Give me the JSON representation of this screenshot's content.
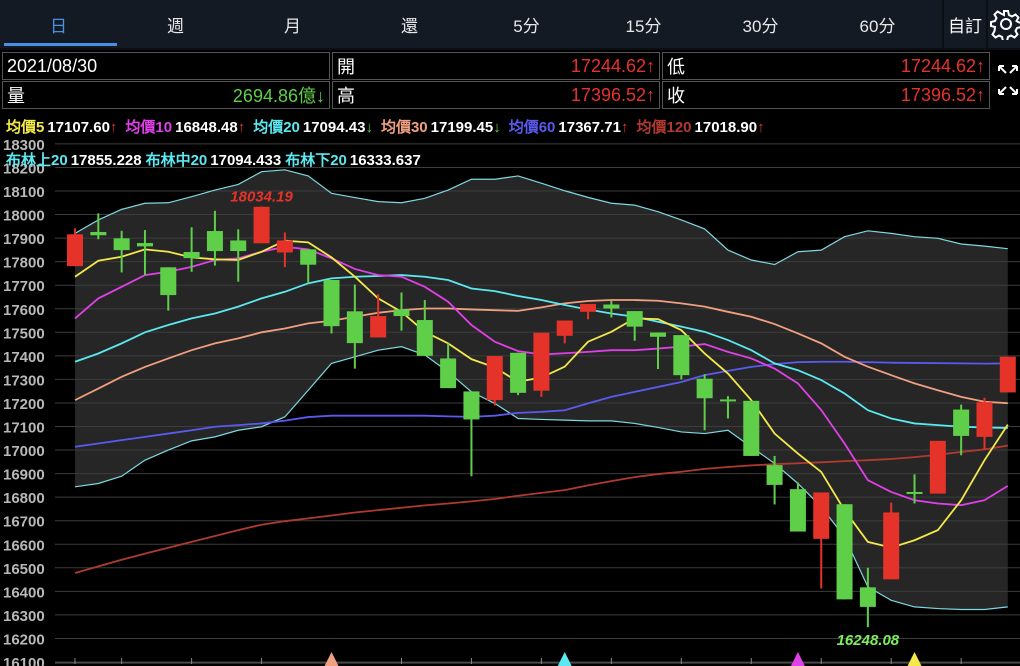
{
  "tabs": [
    "日",
    "週",
    "月",
    "還",
    "5分",
    "15分",
    "30分",
    "60分"
  ],
  "custom_label": "自訂",
  "info": {
    "date": "2021/08/30",
    "open_label": "開",
    "open": "17244.62↑",
    "low_label": "低",
    "low": "17244.62↑",
    "vol_label": "量",
    "vol": "2694.86億↓",
    "high_label": "高",
    "high": "17396.52↑",
    "close_label": "收",
    "close": "17396.52↑"
  },
  "ma_legend": [
    {
      "label": "均價5",
      "value": "17107.60",
      "arrow": "↑",
      "color": "#f4e94a",
      "arrow_color": "#e5332a"
    },
    {
      "label": "均價10",
      "value": "16848.48",
      "arrow": "↑",
      "color": "#e040e8",
      "arrow_color": "#e5332a"
    },
    {
      "label": "均價20",
      "value": "17094.43",
      "arrow": "↓",
      "color": "#5ce8f0",
      "arrow_color": "#5fcf4a"
    },
    {
      "label": "均價30",
      "value": "17199.45",
      "arrow": "↓",
      "color": "#f0a080",
      "arrow_color": "#5fcf4a"
    },
    {
      "label": "均價60",
      "value": "17367.71",
      "arrow": "↑",
      "color": "#5a5af0",
      "arrow_color": "#e5332a"
    },
    {
      "label": "均價120",
      "value": "17018.90",
      "arrow": "↑",
      "color": "#b03a30",
      "arrow_color": "#e5332a"
    }
  ],
  "bb_legend": [
    {
      "label": "布林上20",
      "value": "17855.228"
    },
    {
      "label": "布林中20",
      "value": "17094.433"
    },
    {
      "label": "布林下20",
      "value": "16333.637"
    }
  ],
  "chart_data": {
    "type": "candlestick",
    "ylim": [
      16100,
      18300
    ],
    "yticks": [
      18300,
      18200,
      18100,
      18000,
      17900,
      17800,
      17700,
      17600,
      17500,
      17400,
      17300,
      17200,
      17100,
      17000,
      16900,
      16800,
      16700,
      16600,
      16500,
      16400,
      16300,
      16200,
      16100
    ],
    "candles_ohlc": [
      [
        17781,
        17941,
        17781,
        17916
      ],
      [
        17926,
        18005,
        17895,
        17912
      ],
      [
        17899,
        17931,
        17754,
        17849
      ],
      [
        17879,
        17934,
        17743,
        17865
      ],
      [
        17776,
        17776,
        17592,
        17658
      ],
      [
        17841,
        17946,
        17757,
        17815
      ],
      [
        17930,
        18016,
        17783,
        17845
      ],
      [
        17890,
        17937,
        17715,
        17845
      ],
      [
        17878,
        18034.19,
        17878,
        18033
      ],
      [
        17839,
        17924,
        17777,
        17890
      ],
      [
        17852,
        17852,
        17708,
        17787
      ],
      [
        17722,
        17722,
        17495,
        17526
      ],
      [
        17589,
        17703,
        17346,
        17454
      ],
      [
        17478,
        17662,
        17478,
        17569
      ],
      [
        17597,
        17669,
        17507,
        17569
      ],
      [
        17552,
        17637,
        17400,
        17400
      ],
      [
        17389,
        17453,
        17263,
        17263
      ],
      [
        17249,
        17249,
        16889,
        17130
      ],
      [
        17212,
        17399,
        17189,
        17399
      ],
      [
        17413,
        17413,
        17233,
        17243
      ],
      [
        17252,
        17498,
        17226,
        17498
      ],
      [
        17485,
        17550,
        17453,
        17550
      ],
      [
        17587,
        17620,
        17555,
        17620
      ],
      [
        17618,
        17633,
        17563,
        17601
      ],
      [
        17590,
        17590,
        17464,
        17524
      ],
      [
        17499,
        17499,
        17344,
        17481
      ],
      [
        17488,
        17488,
        17300,
        17318
      ],
      [
        17303,
        17322,
        17084,
        17220
      ],
      [
        17215,
        17229,
        17134,
        17214
      ],
      [
        17209,
        17209,
        16975,
        16975
      ],
      [
        16936,
        16975,
        16769,
        16852
      ],
      [
        16834,
        16862,
        16654,
        16654
      ],
      [
        16623,
        16820,
        16412,
        16820
      ],
      [
        16770,
        16770,
        16366,
        16366
      ],
      [
        16417,
        16500,
        16248.08,
        16334
      ],
      [
        16451,
        16777,
        16451,
        16735
      ],
      [
        16822,
        16897,
        16773,
        16818
      ],
      [
        16815,
        17039,
        16815,
        17039
      ],
      [
        17172,
        17193,
        16978,
        17060
      ],
      [
        17056,
        17222,
        17002,
        17203
      ],
      [
        17244.62,
        17396.52,
        17244.62,
        17396.52
      ]
    ],
    "series": [
      {
        "name": "布林上20",
        "color": "#7fd8e0",
        "values": [
          17920,
          17977,
          18022,
          18048,
          18050,
          18076,
          18104,
          18128,
          18182,
          18190,
          18164,
          18090,
          18072,
          18055,
          18050,
          18069,
          18104,
          18150,
          18150,
          18164,
          18133,
          18101,
          18073,
          18048,
          18040,
          18012,
          17977,
          17939,
          17849,
          17807,
          17788,
          17842,
          17849,
          17906,
          17931,
          17920,
          17906,
          17899,
          17875,
          17866,
          17855
        ]
      },
      {
        "name": "布林下20",
        "color": "#7fd8e0",
        "values": [
          16844,
          16858,
          16889,
          16957,
          17000,
          17039,
          17056,
          17084,
          17099,
          17141,
          17254,
          17368,
          17396,
          17424,
          17439,
          17404,
          17332,
          17247,
          17198,
          17134,
          17130,
          17127,
          17124,
          17124,
          17113,
          17096,
          17077,
          17070,
          17084,
          17013,
          16943,
          16858,
          16759,
          16631,
          16419,
          16362,
          16334,
          16327,
          16323,
          16323,
          16334
        ]
      },
      {
        "name": "均價120",
        "color": "#b03a30",
        "values": [
          16478,
          16506,
          16534,
          16560,
          16585,
          16610,
          16635,
          16660,
          16683,
          16698,
          16710,
          16722,
          16735,
          16745,
          16755,
          16765,
          16773,
          16782,
          16792,
          16806,
          16818,
          16830,
          16850,
          16868,
          16885,
          16898,
          16908,
          16920,
          16928,
          16935,
          16940,
          16944,
          16948,
          16953,
          16957,
          16962,
          16970,
          16980,
          16992,
          17003,
          17019
        ]
      },
      {
        "name": "均價60",
        "color": "#5a5af0",
        "values": [
          17014,
          17028,
          17042,
          17056,
          17070,
          17084,
          17099,
          17106,
          17113,
          17125,
          17140,
          17146,
          17146,
          17146,
          17146,
          17146,
          17143,
          17141,
          17146,
          17158,
          17162,
          17169,
          17198,
          17226,
          17247,
          17268,
          17289,
          17318,
          17336,
          17353,
          17365,
          17373,
          17375,
          17375,
          17373,
          17371,
          17370,
          17369,
          17368,
          17367,
          17368
        ]
      },
      {
        "name": "均價30",
        "color": "#f0a080",
        "values": [
          17212,
          17261,
          17311,
          17353,
          17389,
          17424,
          17453,
          17474,
          17500,
          17516,
          17538,
          17549,
          17566,
          17583,
          17594,
          17601,
          17601,
          17597,
          17594,
          17591,
          17606,
          17623,
          17633,
          17637,
          17637,
          17634,
          17623,
          17609,
          17587,
          17566,
          17535,
          17495,
          17453,
          17396,
          17354,
          17318,
          17283,
          17254,
          17226,
          17205,
          17199
        ]
      },
      {
        "name": "均價20",
        "color": "#5ce8f0",
        "values": [
          17375,
          17410,
          17453,
          17500,
          17531,
          17559,
          17580,
          17609,
          17644,
          17672,
          17708,
          17729,
          17736,
          17739,
          17743,
          17736,
          17722,
          17686,
          17675,
          17654,
          17637,
          17616,
          17597,
          17580,
          17566,
          17545,
          17524,
          17502,
          17467,
          17424,
          17368,
          17339,
          17297,
          17240,
          17169,
          17134,
          17113,
          17106,
          17099,
          17096,
          17094
        ]
      },
      {
        "name": "均價10",
        "color": "#e040e8",
        "values": [
          17559,
          17644,
          17693,
          17743,
          17757,
          17778,
          17807,
          17814,
          17842,
          17863,
          17852,
          17814,
          17769,
          17743,
          17736,
          17693,
          17630,
          17531,
          17460,
          17420,
          17406,
          17411,
          17417,
          17424,
          17424,
          17431,
          17439,
          17450,
          17417,
          17389,
          17346,
          17283,
          17170,
          17028,
          16872,
          16822,
          16787,
          16773,
          16766,
          16787,
          16848
        ]
      },
      {
        "name": "均價5",
        "color": "#f4e94a",
        "values": [
          17736,
          17804,
          17821,
          17852,
          17842,
          17818,
          17810,
          17807,
          17842,
          17889,
          17882,
          17818,
          17736,
          17644,
          17587,
          17502,
          17453,
          17386,
          17351,
          17290,
          17308,
          17354,
          17460,
          17502,
          17559,
          17556,
          17509,
          17410,
          17325,
          17212,
          17070,
          16985,
          16907,
          16744,
          16610,
          16586,
          16617,
          16660,
          16787,
          16957,
          17108
        ]
      }
    ],
    "annotations": [
      {
        "text": "18034.19",
        "candle": 8,
        "color": "#e5332a"
      },
      {
        "text": "16248.08",
        "candle": 34,
        "color": "#7cf05a"
      }
    ],
    "markers": [
      {
        "candle": 11,
        "color": "#f0a080"
      },
      {
        "candle": 21,
        "color": "#5ce8f0"
      },
      {
        "candle": 31,
        "color": "#e040e8"
      },
      {
        "candle": 36,
        "color": "#f4e94a"
      }
    ],
    "up_color": "#e5332a",
    "down_color": "#5fcf4a"
  }
}
